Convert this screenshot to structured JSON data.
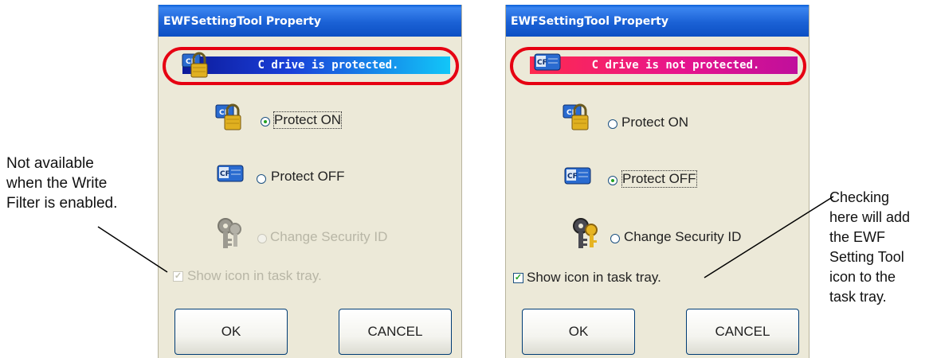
{
  "left_dialog": {
    "title": "EWFSettingTool Property",
    "status_text": "C drive is protected.",
    "protect_on_label": "Protect ON",
    "protect_off_label": "Protect OFF",
    "change_security_label": "Change Security ID",
    "show_icon_label": "Show icon in task tray.",
    "ok_label": "OK",
    "cancel_label": "CANCEL",
    "selected_option": "Protect ON",
    "show_icon_checked": true,
    "change_security_enabled": false,
    "show_icon_enabled": false
  },
  "right_dialog": {
    "title": "EWFSettingTool Property",
    "status_text": "C drive is not protected.",
    "protect_on_label": "Protect ON",
    "protect_off_label": "Protect OFF",
    "change_security_label": "Change Security ID",
    "show_icon_label": "Show icon in task tray.",
    "ok_label": "OK",
    "cancel_label": "CANCEL",
    "selected_option": "Protect OFF",
    "show_icon_checked": true,
    "change_security_enabled": true,
    "show_icon_enabled": true
  },
  "annotations": {
    "left": [
      "Not available",
      "when the Write",
      "Filter is enabled."
    ],
    "right": [
      "Checking",
      "here will add",
      "the EWF",
      "Setting Tool",
      "icon to the",
      "task tray."
    ]
  },
  "icons": {
    "status_on": "padlock-cf-card-icon",
    "status_off": "cf-card-icon",
    "protect_on": "padlock-cf-card-icon",
    "protect_off": "cf-card-icon",
    "change_security": "keys-icon"
  },
  "colors": {
    "highlight_ring": "#e60012",
    "status_on_gradient": [
      "#0c1a9a",
      "#12c6f8"
    ],
    "status_off_gradient": [
      "#ff2a4e",
      "#c00f9c"
    ],
    "titlebar": "#1b62d6",
    "dialog_bg": "#ece9d8"
  }
}
